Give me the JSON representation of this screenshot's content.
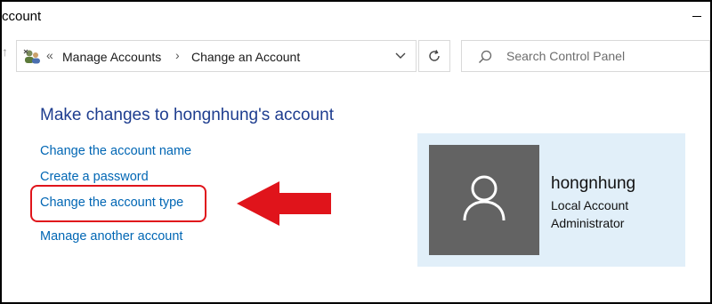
{
  "window": {
    "title": "ccount"
  },
  "address_bar": {
    "chevrons": "«",
    "breadcrumbs": [
      "Manage Accounts",
      "Change an Account"
    ],
    "separator": "›"
  },
  "search": {
    "placeholder": "Search Control Panel"
  },
  "main": {
    "heading": "Make changes to hongnhung's account",
    "links": [
      "Change the account name",
      "Create a password",
      "Change the account type",
      "Manage another account"
    ]
  },
  "user": {
    "name": "hongnhung",
    "account_kind": "Local Account",
    "role": "Administrator"
  },
  "colors": {
    "heading": "#1e3d8f",
    "link": "#0066b4",
    "annotation": "#e0141b",
    "card_bg": "#e1eff9",
    "avatar_bg": "#636363"
  },
  "icons": [
    "users-icon",
    "chevron-down-icon",
    "refresh-icon",
    "search-icon",
    "user-silhouette-icon",
    "minimize-icon"
  ]
}
